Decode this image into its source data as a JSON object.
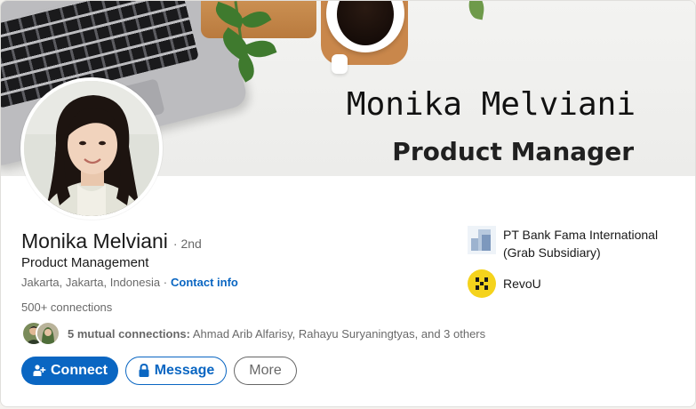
{
  "banner": {
    "name_text": "Monika Melviani",
    "role_text": "Product Manager"
  },
  "profile": {
    "name": "Monika Melviani",
    "degree": "· 2nd",
    "headline": "Product Management",
    "location": "Jakarta, Jakarta, Indonesia ·",
    "contact_info_label": "Contact info",
    "connections": "500+ connections",
    "mutual_bold": "5 mutual connections:",
    "mutual_names": " Ahmad Arib Alfarisy, Rahayu Suryaningtyas, and 3 others"
  },
  "actions": {
    "connect_label": "Connect",
    "message_label": "Message",
    "more_label": "More"
  },
  "experience": [
    {
      "name": "PT Bank Fama International (Grab Subsidiary)",
      "logo_icon": "building-squares-logo"
    },
    {
      "name": "RevoU",
      "logo_icon": "revou-logo"
    }
  ],
  "colors": {
    "primary_blue": "#0a66c2",
    "revou_yellow": "#f5d31c",
    "text_secondary": "rgba(0,0,0,0.6)"
  }
}
